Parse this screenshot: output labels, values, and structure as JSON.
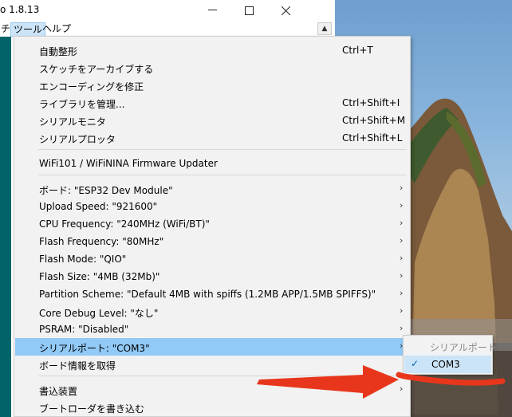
{
  "window": {
    "title": "o 1.8.13",
    "minimize_icon": "minimize-icon",
    "maximize_icon": "maximize-icon",
    "close_icon": "close-icon"
  },
  "menubar": {
    "items": [
      {
        "label": "チ"
      },
      {
        "label": "ツール"
      },
      {
        "label": "ヘルプ"
      }
    ]
  },
  "dropdown": {
    "items": [
      {
        "label": "自動整形",
        "shortcut": "Ctrl+T"
      },
      {
        "label": "スケッチをアーカイブする",
        "shortcut": ""
      },
      {
        "label": "エンコーディングを修正",
        "shortcut": ""
      },
      {
        "label": "ライブラリを管理...",
        "shortcut": "Ctrl+Shift+I"
      },
      {
        "label": "シリアルモニタ",
        "shortcut": "Ctrl+Shift+M"
      },
      {
        "label": "シリアルプロッタ",
        "shortcut": "Ctrl+Shift+L"
      },
      {
        "label": "WiFi101 / WiFiNINA Firmware Updater",
        "shortcut": ""
      },
      {
        "label": "ボード: \"ESP32 Dev Module\""
      },
      {
        "label": "Upload Speed: \"921600\""
      },
      {
        "label": "CPU Frequency: \"240MHz (WiFi/BT)\""
      },
      {
        "label": "Flash Frequency: \"80MHz\""
      },
      {
        "label": "Flash Mode: \"QIO\""
      },
      {
        "label": "Flash Size: \"4MB (32Mb)\""
      },
      {
        "label": "Partition Scheme: \"Default 4MB with spiffs (1.2MB APP/1.5MB SPIFFS)\""
      },
      {
        "label": "Core Debug Level: \"なし\""
      },
      {
        "label": "PSRAM: \"Disabled\""
      },
      {
        "label": "シリアルポート: \"COM3\""
      },
      {
        "label": "ボード情報を取得"
      },
      {
        "label": "書込装置"
      },
      {
        "label": "ブートローダを書き込む"
      }
    ],
    "submenu_arrow": "›"
  },
  "submenu": {
    "header": "シリアルポート",
    "item_label": "COM3",
    "check_icon": "✓"
  },
  "colors": {
    "highlight": "#91c9f7",
    "annotation_red": "#e8361c",
    "arduino_teal": "#006468"
  }
}
